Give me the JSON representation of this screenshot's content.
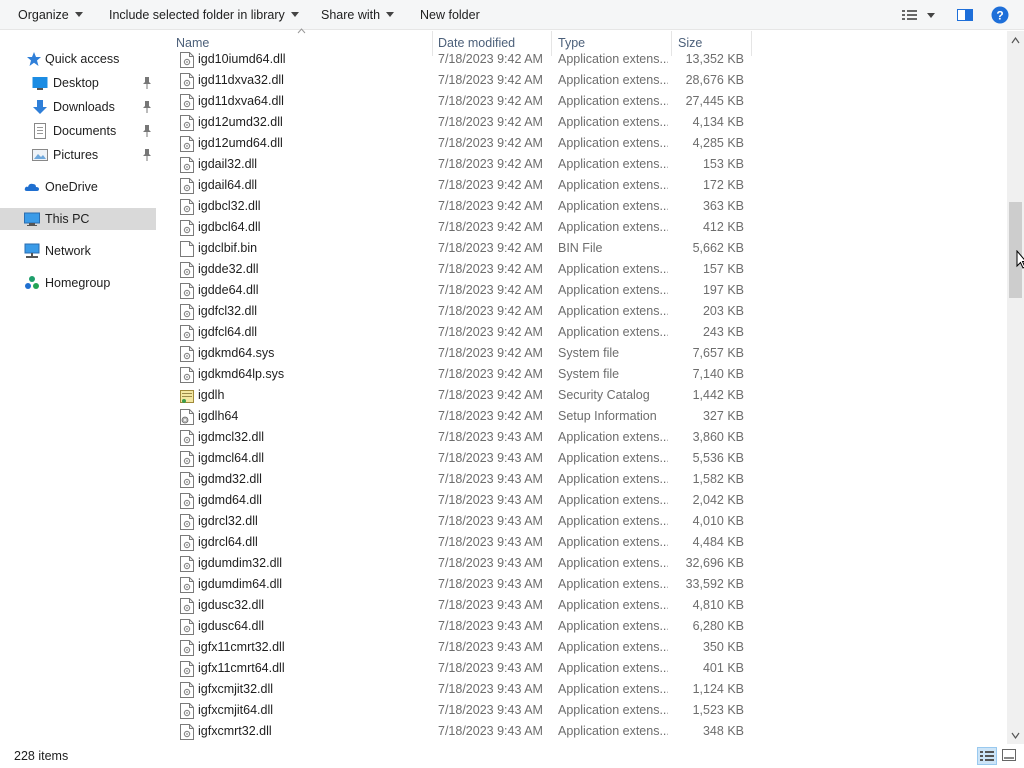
{
  "toolbar": {
    "organize": "Organize",
    "include": "Include selected folder in library",
    "share": "Share with",
    "new_folder": "New folder"
  },
  "nav": {
    "quick_access": "Quick access",
    "desktop": "Desktop",
    "downloads": "Downloads",
    "documents": "Documents",
    "pictures": "Pictures",
    "onedrive": "OneDrive",
    "this_pc": "This PC",
    "network": "Network",
    "homegroup": "Homegroup"
  },
  "columns": {
    "name": "Name",
    "date": "Date modified",
    "type": "Type",
    "size": "Size"
  },
  "files": [
    {
      "name": "igd10iumd64.dll",
      "date": "7/18/2023 9:42 AM",
      "type": "Application extens...",
      "size": "13,352 KB",
      "icon": "dll-icon"
    },
    {
      "name": "igd11dxva32.dll",
      "date": "7/18/2023 9:42 AM",
      "type": "Application extens...",
      "size": "28,676 KB",
      "icon": "dll-icon"
    },
    {
      "name": "igd11dxva64.dll",
      "date": "7/18/2023 9:42 AM",
      "type": "Application extens...",
      "size": "27,445 KB",
      "icon": "dll-icon"
    },
    {
      "name": "igd12umd32.dll",
      "date": "7/18/2023 9:42 AM",
      "type": "Application extens...",
      "size": "4,134 KB",
      "icon": "dll-icon"
    },
    {
      "name": "igd12umd64.dll",
      "date": "7/18/2023 9:42 AM",
      "type": "Application extens...",
      "size": "4,285 KB",
      "icon": "dll-icon"
    },
    {
      "name": "igdail32.dll",
      "date": "7/18/2023 9:42 AM",
      "type": "Application extens...",
      "size": "153 KB",
      "icon": "dll-icon"
    },
    {
      "name": "igdail64.dll",
      "date": "7/18/2023 9:42 AM",
      "type": "Application extens...",
      "size": "172 KB",
      "icon": "dll-icon"
    },
    {
      "name": "igdbcl32.dll",
      "date": "7/18/2023 9:42 AM",
      "type": "Application extens...",
      "size": "363 KB",
      "icon": "dll-icon"
    },
    {
      "name": "igdbcl64.dll",
      "date": "7/18/2023 9:42 AM",
      "type": "Application extens...",
      "size": "412 KB",
      "icon": "dll-icon"
    },
    {
      "name": "igdclbif.bin",
      "date": "7/18/2023 9:42 AM",
      "type": "BIN File",
      "size": "5,662 KB",
      "icon": "blank-file-icon"
    },
    {
      "name": "igdde32.dll",
      "date": "7/18/2023 9:42 AM",
      "type": "Application extens...",
      "size": "157 KB",
      "icon": "dll-icon"
    },
    {
      "name": "igdde64.dll",
      "date": "7/18/2023 9:42 AM",
      "type": "Application extens...",
      "size": "197 KB",
      "icon": "dll-icon"
    },
    {
      "name": "igdfcl32.dll",
      "date": "7/18/2023 9:42 AM",
      "type": "Application extens...",
      "size": "203 KB",
      "icon": "dll-icon"
    },
    {
      "name": "igdfcl64.dll",
      "date": "7/18/2023 9:42 AM",
      "type": "Application extens...",
      "size": "243 KB",
      "icon": "dll-icon"
    },
    {
      "name": "igdkmd64.sys",
      "date": "7/18/2023 9:42 AM",
      "type": "System file",
      "size": "7,657 KB",
      "icon": "sys-icon"
    },
    {
      "name": "igdkmd64lp.sys",
      "date": "7/18/2023 9:42 AM",
      "type": "System file",
      "size": "7,140 KB",
      "icon": "sys-icon"
    },
    {
      "name": "igdlh",
      "date": "7/18/2023 9:42 AM",
      "type": "Security Catalog",
      "size": "1,442 KB",
      "icon": "catalog-icon"
    },
    {
      "name": "igdlh64",
      "date": "7/18/2023 9:42 AM",
      "type": "Setup Information",
      "size": "327 KB",
      "icon": "inf-icon"
    },
    {
      "name": "igdmcl32.dll",
      "date": "7/18/2023 9:43 AM",
      "type": "Application extens...",
      "size": "3,860 KB",
      "icon": "dll-icon"
    },
    {
      "name": "igdmcl64.dll",
      "date": "7/18/2023 9:43 AM",
      "type": "Application extens...",
      "size": "5,536 KB",
      "icon": "dll-icon"
    },
    {
      "name": "igdmd32.dll",
      "date": "7/18/2023 9:43 AM",
      "type": "Application extens...",
      "size": "1,582 KB",
      "icon": "dll-icon"
    },
    {
      "name": "igdmd64.dll",
      "date": "7/18/2023 9:43 AM",
      "type": "Application extens...",
      "size": "2,042 KB",
      "icon": "dll-icon"
    },
    {
      "name": "igdrcl32.dll",
      "date": "7/18/2023 9:43 AM",
      "type": "Application extens...",
      "size": "4,010 KB",
      "icon": "dll-icon"
    },
    {
      "name": "igdrcl64.dll",
      "date": "7/18/2023 9:43 AM",
      "type": "Application extens...",
      "size": "4,484 KB",
      "icon": "dll-icon"
    },
    {
      "name": "igdumdim32.dll",
      "date": "7/18/2023 9:43 AM",
      "type": "Application extens...",
      "size": "32,696 KB",
      "icon": "dll-icon"
    },
    {
      "name": "igdumdim64.dll",
      "date": "7/18/2023 9:43 AM",
      "type": "Application extens...",
      "size": "33,592 KB",
      "icon": "dll-icon"
    },
    {
      "name": "igdusc32.dll",
      "date": "7/18/2023 9:43 AM",
      "type": "Application extens...",
      "size": "4,810 KB",
      "icon": "dll-icon"
    },
    {
      "name": "igdusc64.dll",
      "date": "7/18/2023 9:43 AM",
      "type": "Application extens...",
      "size": "6,280 KB",
      "icon": "dll-icon"
    },
    {
      "name": "igfx11cmrt32.dll",
      "date": "7/18/2023 9:43 AM",
      "type": "Application extens...",
      "size": "350 KB",
      "icon": "dll-icon"
    },
    {
      "name": "igfx11cmrt64.dll",
      "date": "7/18/2023 9:43 AM",
      "type": "Application extens...",
      "size": "401 KB",
      "icon": "dll-icon"
    },
    {
      "name": "igfxcmjit32.dll",
      "date": "7/18/2023 9:43 AM",
      "type": "Application extens...",
      "size": "1,124 KB",
      "icon": "dll-icon"
    },
    {
      "name": "igfxcmjit64.dll",
      "date": "7/18/2023 9:43 AM",
      "type": "Application extens...",
      "size": "1,523 KB",
      "icon": "dll-icon"
    },
    {
      "name": "igfxcmrt32.dll",
      "date": "7/18/2023 9:43 AM",
      "type": "Application extens...",
      "size": "348 KB",
      "icon": "dll-icon"
    }
  ],
  "status": {
    "item_count": "228 items"
  },
  "colors": {
    "toolbar_bg": "#f5f6f7",
    "selected_nav_bg": "#d9d9d9",
    "header_text": "#4c607a",
    "detail_text": "#6d6d6d",
    "help_blue": "#1e6fd9"
  }
}
